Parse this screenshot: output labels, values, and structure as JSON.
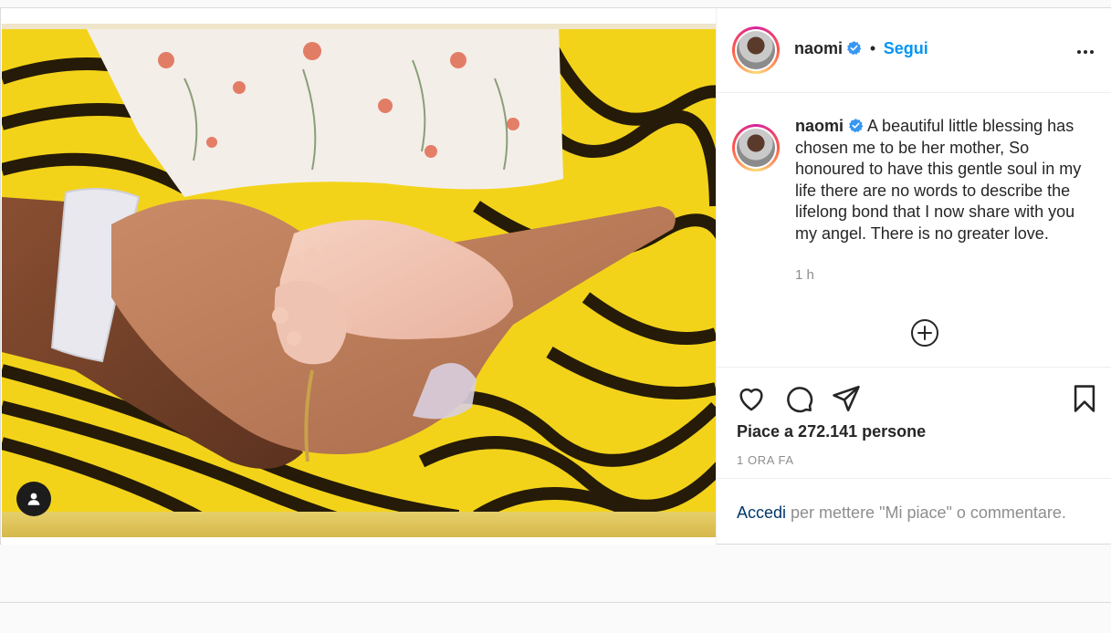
{
  "post": {
    "author": {
      "username": "naomi",
      "verified_icon": "verified-badge-icon",
      "follow_label": "Segui",
      "separator": "•"
    },
    "caption": {
      "username": "naomi",
      "text": "A beautiful little blessing has chosen me to be her mother, So honoured to have this gentle soul in my life there are no words to describe the lifelong bond that I now share with you my angel. There is no greater love.",
      "time_ago": "1 h"
    },
    "actions": {
      "like_icon": "heart-icon",
      "comment_icon": "comment-icon",
      "share_icon": "paper-plane-icon",
      "save_icon": "bookmark-icon",
      "more_icon": "more-options-icon",
      "load_more_icon": "plus-circle-icon"
    },
    "likes_text": "Piace a 272.141 persone",
    "date_text": "1 ORA FA",
    "login_prompt": {
      "link": "Accedi",
      "rest": " per mettere \"Mi piace\" o commentare."
    },
    "media": {
      "tag_icon": "user-tag-icon"
    }
  },
  "colors": {
    "accent": "#0095f6",
    "text": "#262626",
    "muted": "#8e8e8e",
    "link": "#00376b",
    "photo_yellow": "#f2d21b"
  }
}
